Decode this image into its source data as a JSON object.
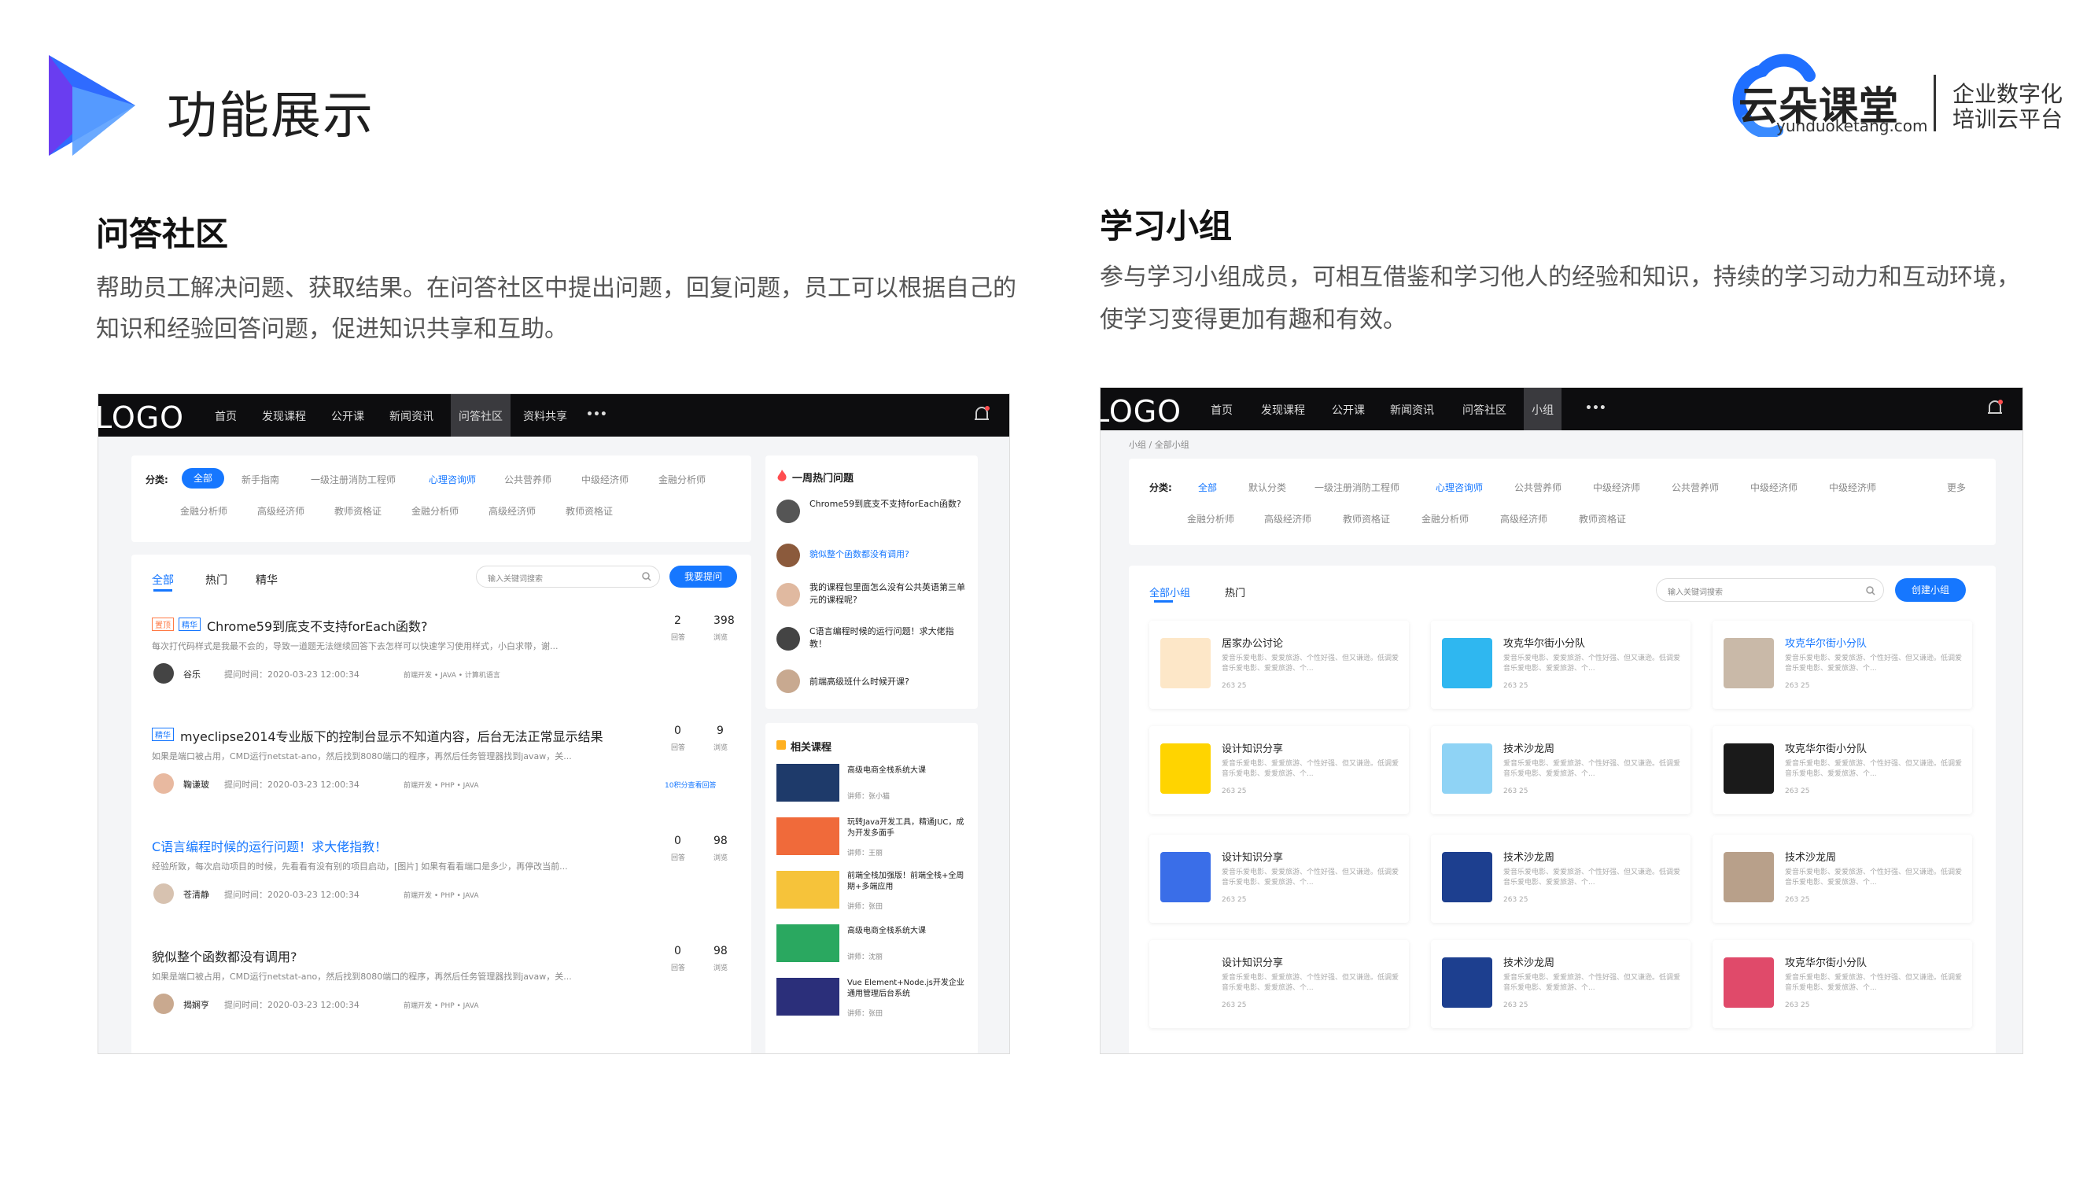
{
  "slide": {
    "title": "功能展示",
    "brand": {
      "name": "云朵课堂",
      "url": "yunduoketang.com",
      "tagline1": "企业数字化",
      "tagline2": "培训云平台"
    },
    "colors": {
      "accent": "#1677ff",
      "logo_blue": "#2f6bff",
      "logo_purple": "#6a3df0"
    }
  },
  "qa": {
    "heading": "问答社区",
    "desc1": "帮助员工解决问题、获取结果。在问答社区中提出问题，回复问题，员工可以根据自己的",
    "desc2": "知识和经验回答问题，促进知识共享和互助。",
    "logo": "LOGO",
    "nav": [
      "首页",
      "发现课程",
      "公开课",
      "新闻资讯",
      "问答社区",
      "资料共享",
      "•••"
    ],
    "filter_label": "分类:",
    "filters_row1": [
      "全部",
      "新手指南",
      "一级注册消防工程师",
      "心理咨询师",
      "公共营养师",
      "中级经济师",
      "金融分析师"
    ],
    "filters_row2": [
      "金融分析师",
      "高级经济师",
      "教师资格证",
      "金融分析师",
      "高级经济师",
      "教师资格证"
    ],
    "tabs": [
      "全部",
      "热门",
      "精华"
    ],
    "search_placeholder": "输入关键词搜索",
    "ask_button": "我要提问",
    "questions": [
      {
        "tags": [
          "置顶",
          "精华"
        ],
        "title": "Chrome59到底支不支持forEach函数?",
        "excerpt": "每次打代码样式是我最不会的，导致一道题无法继续回答下去怎样可以快速学习使用样式，小白求带，谢...",
        "user": "谷乐",
        "time": "提问时间：2020-03-23 12:00:34",
        "cat": "前端开发 • JAVA • 计算机语言",
        "answers": "2",
        "views": "398",
        "extra": ""
      },
      {
        "tags": [
          "精华"
        ],
        "title": "myeclipse2014专业版下的控制台显示不知道内容，后台无法正常显示结果",
        "excerpt": "如果是端口被占用，CMD运行netstat-ano，然后找到8080端口的程序，再然后任务管理器找到javaw，关...",
        "user": "鞠谦玻",
        "time": "提问时间：2020-03-23 12:00:34",
        "cat": "前端开发 • PHP • JAVA",
        "answers": "0",
        "views": "9",
        "extra": "10积分查看回答"
      },
      {
        "tags": [],
        "title": "C语言编程时候的运行问题！求大佬指教！",
        "excerpt": "经验所致，每次启动项目的时候，先看看有没有别的项目启动，[图片] 如果有看看端口是多少，再停改当前...",
        "user": "苍清静",
        "time": "提问时间：2020-03-23 12:00:34",
        "cat": "前端开发 • PHP • JAVA",
        "answers": "0",
        "views": "98",
        "extra": ""
      },
      {
        "tags": [],
        "title": "貌似整个函数都没有调用?",
        "excerpt": "如果是端口被占用，CMD运行netstat-ano，然后找到8080端口的程序，再然后任务管理器找到javaw，关...",
        "user": "揭娴亨",
        "time": "提问时间：2020-03-23 12:00:34",
        "cat": "前端开发 • PHP • JAVA",
        "answers": "0",
        "views": "98",
        "extra": ""
      }
    ],
    "answers_label": "回答",
    "views_label": "浏览",
    "hot_title": "一周热门问题",
    "hot": [
      "Chrome59到底支不支持forEach函数?",
      "貌似整个函数都没有调用?",
      "我的课程包里面怎么没有公共英语第三单元的课程呢?",
      "C语言编程时候的运行问题！求大佬指教！",
      "前端高级班什么时候开课?"
    ],
    "related_title": "相关课程",
    "courses": [
      {
        "name": "高级电商全栈系统大课",
        "lecturer": "讲师：张小猫"
      },
      {
        "name": "玩转Java开发工具，精通JUC，成为开发多面手",
        "lecturer": "讲师：王丽"
      },
      {
        "name": "前端全栈加强版！前端全栈+全周期+多端应用",
        "lecturer": "讲师：张田"
      },
      {
        "name": "高级电商全栈系统大课",
        "lecturer": "讲师：沈丽"
      },
      {
        "name": "Vue Element+Node.js开发企业通用管理后台系统",
        "lecturer": "讲师：张田"
      }
    ]
  },
  "group": {
    "heading": "学习小组",
    "desc1": "参与学习小组成员，可相互借鉴和学习他人的经验和知识，持续的学习动力和互动环境，",
    "desc2": "使学习变得更加有趣和有效。",
    "logo": "LOGO",
    "nav": [
      "首页",
      "发现课程",
      "公开课",
      "新闻资讯",
      "问答社区",
      "小组",
      "•••"
    ],
    "breadcrumb": "小组 / 全部小组",
    "filter_label": "分类:",
    "filters_row1": [
      "全部",
      "默认分类",
      "一级注册消防工程师",
      "心理咨询师",
      "公共营养师",
      "中级经济师",
      "公共营养师",
      "中级经济师",
      "中级经济师",
      "更多"
    ],
    "filters_row2": [
      "金融分析师",
      "高级经济师",
      "教师资格证",
      "金融分析师",
      "高级经济师",
      "教师资格证"
    ],
    "tabs": [
      "全部小组",
      "热门"
    ],
    "search_placeholder": "输入关键词搜索",
    "create_button": "创建小组",
    "desc_text": "爱音乐爱电影、爱爱旅游、个性好强、但又谦逊。低调爱音乐爱电影、爱爱旅游、个...",
    "stats": "263  25",
    "groups": [
      {
        "name": "居家办公讨论",
        "icon": "chair-icon",
        "bg": "#fde7c8"
      },
      {
        "name": "攻克华尔街小分队",
        "icon": "glasses-icon",
        "bg": "#2fb7f0"
      },
      {
        "name": "攻克华尔街小分队",
        "icon": "photo-icon",
        "bg": "#c9b9a8"
      },
      {
        "name": "设计知识分享",
        "icon": "brush-icon",
        "bg": "#ffd400"
      },
      {
        "name": "技术沙龙周",
        "icon": "toggle-icon",
        "bg": "#8fd3f5"
      },
      {
        "name": "攻克华尔街小分队",
        "icon": "trophy-icon",
        "bg": "#1a1a1a"
      },
      {
        "name": "设计知识分享",
        "icon": "person-icon",
        "bg": "#3a6ee8"
      },
      {
        "name": "技术沙龙周",
        "icon": "helmet-icon",
        "bg": "#1d3f8f"
      },
      {
        "name": "技术沙龙周",
        "icon": "photo-icon",
        "bg": "#b8a08a"
      },
      {
        "name": "设计知识分享",
        "icon": "robot-icon",
        "bg": "#ffffff"
      },
      {
        "name": "技术沙龙周",
        "icon": "helmet-icon",
        "bg": "#1d3f8f"
      },
      {
        "name": "攻克华尔街小分队",
        "icon": "art-icon",
        "bg": "#e04a6a"
      }
    ]
  }
}
